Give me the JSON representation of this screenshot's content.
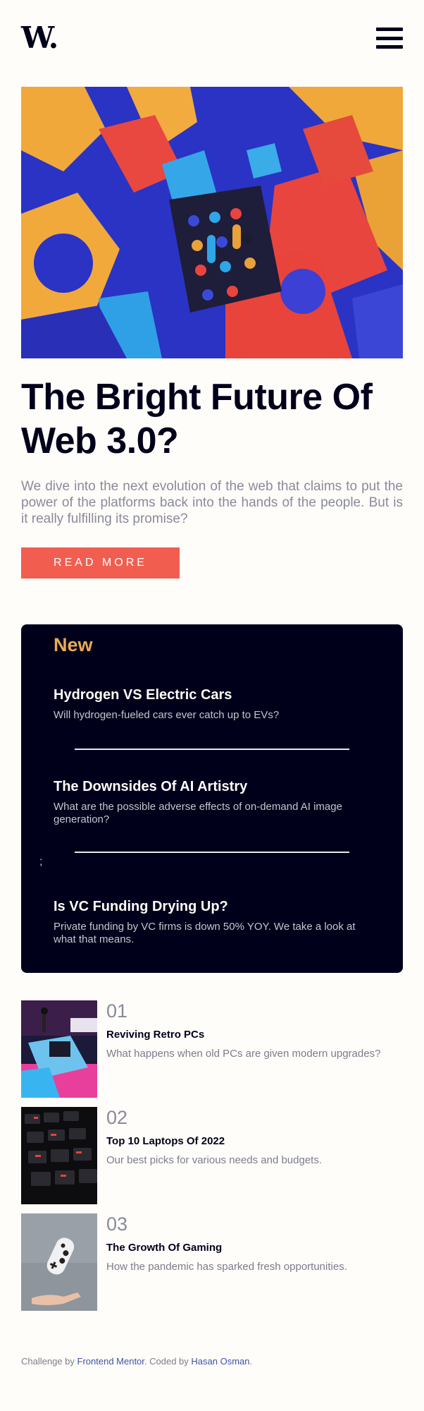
{
  "header": {
    "logo": "W.",
    "menu_icon": "hamburger-menu-icon"
  },
  "hero": {
    "title": "The Bright Future Of Web 3.0?",
    "description": "We dive into the next evolution of the web that claims to put the power of the platforms back into the hands of the people. But is it really fulfilling its promise?",
    "button": "READ MORE"
  },
  "new_section": {
    "heading": "New",
    "stray_text": ";",
    "items": [
      {
        "title": "Hydrogen VS Electric Cars",
        "text": "Will hydrogen-fueled cars ever catch up to EVs?"
      },
      {
        "title": "The Downsides Of AI Artistry",
        "text": "What are the possible adverse effects of on-demand AI image generation?"
      },
      {
        "title": "Is VC Funding Drying Up?",
        "text": "Private funding by VC firms is down 50% YOY. We take a look at what that means."
      }
    ]
  },
  "list": [
    {
      "number": "01",
      "title": "Reviving Retro PCs",
      "text": "What happens when old PCs are given modern upgrades?"
    },
    {
      "number": "02",
      "title": "Top 10 Laptops Of 2022",
      "text": "Our best picks for various needs and budgets."
    },
    {
      "number": "03",
      "title": "The Growth Of Gaming",
      "text": "How the pandemic has sparked fresh opportunities."
    }
  ],
  "footer": {
    "prefix": "Challenge by",
    "link1": "Frontend Mentor",
    "middle": ". Coded by",
    "link2": "Hasan Osman",
    "suffix": "."
  },
  "colors": {
    "accent": "#f15e50",
    "dark": "#00001a",
    "new_heading": "#e9ab53",
    "link": "#3e52a3"
  }
}
